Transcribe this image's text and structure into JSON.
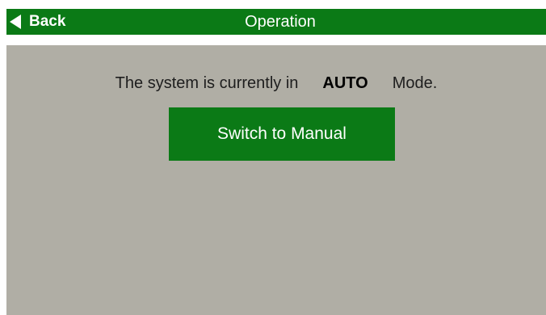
{
  "header": {
    "back_label": "Back",
    "title": "Operation"
  },
  "status": {
    "prefix": "The system is currently in",
    "mode": "AUTO",
    "suffix": "Mode."
  },
  "actions": {
    "switch_label": "Switch to Manual"
  },
  "colors": {
    "header_bg": "#0b7a16",
    "content_bg": "#b0aea5",
    "button_bg": "#0b7a16"
  }
}
